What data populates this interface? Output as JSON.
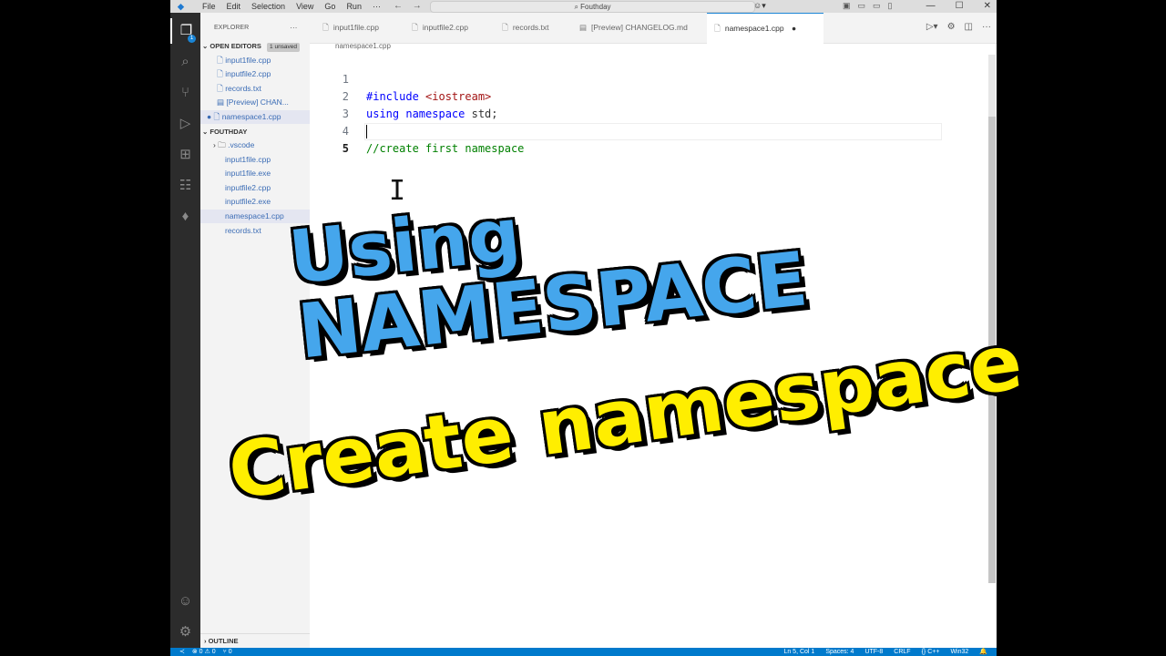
{
  "titlebar": {
    "menu": [
      "File",
      "Edit",
      "Selection",
      "View",
      "Go",
      "Run",
      "···"
    ],
    "command_center": "Fouthday"
  },
  "activity_badge": "1",
  "sidebar": {
    "explorer_label": "EXPLORER",
    "open_editors_label": "OPEN EDITORS",
    "unsaved_badge": "1 unsaved",
    "open_editors": [
      "input1file.cpp",
      "inputfile2.cpp",
      "records.txt",
      "[Preview] CHAN...",
      "namespace1.cpp"
    ],
    "folder_label": "FOUTHDAY",
    "files": [
      ".vscode",
      "input1file.cpp",
      "input1file.exe",
      "inputfile2.cpp",
      "inputfile2.exe",
      "namespace1.cpp",
      "records.txt"
    ],
    "outline_label": "OUTLINE"
  },
  "tabs": [
    "input1file.cpp",
    "inputfile2.cpp",
    "records.txt",
    "[Preview] CHANGELOG.md",
    "namespace1.cpp"
  ],
  "breadcrumb": "namespace1.cpp",
  "editor": {
    "line_numbers": [
      "1",
      "2",
      "3",
      "4",
      "5"
    ],
    "lines": {
      "l1_directive": "#include",
      "l1_header": " <iostream>",
      "l2_using": "using",
      "l2_namespace": " namespace",
      "l2_std": " std;",
      "l4_comment": "//create first namespace"
    }
  },
  "statusbar": {
    "problems": "⊗ 0 ⚠ 0",
    "ports": "⑂ 0",
    "position": "Ln 5, Col 1",
    "spaces": "Spaces: 4",
    "encoding": "UTF-8",
    "eol": "CRLF",
    "language": "{} C++",
    "platform": "Win32"
  },
  "overlay": {
    "line1": "Using",
    "line2": "NAMESPACE",
    "line3": "Create namespace"
  },
  "colors": {
    "overlay_blue": "#45a6ec",
    "overlay_yellow": "#ffee00",
    "statusbar": "#007acc",
    "activity_bar": "#2c2c2c"
  }
}
